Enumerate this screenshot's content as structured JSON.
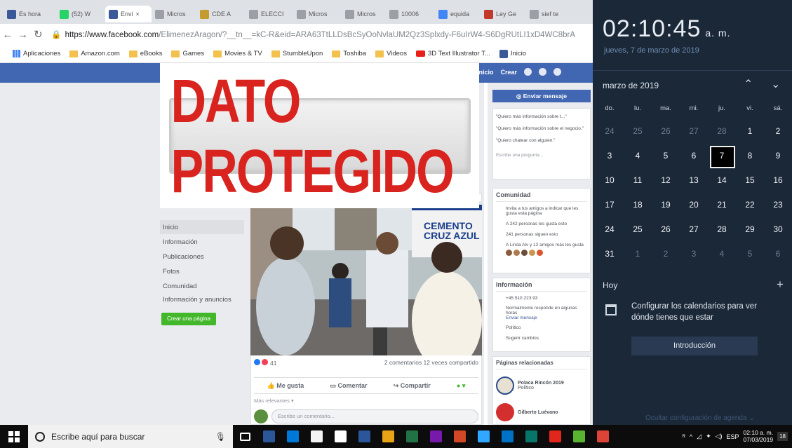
{
  "browser": {
    "tabs": [
      {
        "label": "Es hora",
        "color": "#3b5998"
      },
      {
        "label": "(52) W",
        "color": "#25d366"
      },
      {
        "label": "Envi",
        "color": "#3b5998",
        "active": true
      },
      {
        "label": "Micros",
        "color": "#9aa0a6"
      },
      {
        "label": "CDE A",
        "color": "#c49b2d"
      },
      {
        "label": "ELECCI",
        "color": "#9aa0a6"
      },
      {
        "label": "Micros",
        "color": "#9aa0a6"
      },
      {
        "label": "Micros",
        "color": "#9aa0a6"
      },
      {
        "label": "10006",
        "color": "#9aa0a6"
      },
      {
        "label": "equida",
        "color": "#4285f4"
      },
      {
        "label": "Ley Ge",
        "color": "#c0392b"
      },
      {
        "label": "sief te",
        "color": "#9aa0a6"
      }
    ],
    "close_glyph": "×",
    "url_main": "https://www.facebook.com",
    "url_rest": "/ElimenezAragon/?__tn__=kC-R&eid=ARA63TtLLDsBcSyOoNvlaUM2Qz3Splxdy-F6uIrW4-S6DgRUtLI1xD4WC8brA",
    "bookmarks": [
      {
        "label": "Aplicaciones",
        "icon": "apps-grid-icon"
      },
      {
        "label": "Amazon.com",
        "icon": "folder-icon"
      },
      {
        "label": "eBooks",
        "icon": "folder-icon"
      },
      {
        "label": "Games",
        "icon": "folder-icon"
      },
      {
        "label": "Movies & TV",
        "icon": "folder-icon"
      },
      {
        "label": "StumbleUpon",
        "icon": "folder-icon"
      },
      {
        "label": "Toshiba",
        "icon": "folder-icon"
      },
      {
        "label": "Videos",
        "icon": "folder-icon"
      },
      {
        "label": "3D Text Illustrator T...",
        "icon": "youtube-icon"
      },
      {
        "label": "Inicio",
        "icon": "facebook-icon"
      }
    ]
  },
  "facebook": {
    "nav_home": "Inicio",
    "nav_create": "Crear",
    "banner_text": "DATO PROTEGIDO",
    "side_menu": [
      "Inicio",
      "Información",
      "Publicaciones",
      "Fotos",
      "Comunidad",
      "Información y anuncios"
    ],
    "create_page_button": "Crear una página",
    "post": {
      "reactions_count": "41",
      "comments_shares": "2 comentarios  12 veces compartido",
      "like_label": "Me gusta",
      "comment_label": "Comentar",
      "share_label": "Compartir",
      "sort_label": "Más relevantes ▾",
      "comment_placeholder": "Escribe un comentario...",
      "sign_line1": "CEMENTO",
      "sign_line2": "CRUZ AZUL"
    },
    "messenger": {
      "button": "Enviar mensaje",
      "suggestions": [
        "\"Quiero más información sobre t...\"",
        "\"Quiero más información sobre el negocio.\"",
        "\"Quiero chatear con alguien.\""
      ],
      "ask_placeholder": "Escribe una pregunta..."
    },
    "community": {
      "title": "Comunidad",
      "items": [
        "Invita a tus amigos a indicar que les gusta esta página",
        "A 242 personas les gusta esto",
        "241 personas siguen esto",
        "A Linda Alv y 12 amigos más les gusta"
      ]
    },
    "info": {
      "title": "Información",
      "phone": "+45 510 223 93",
      "response": "Normalmente responde en algunas horas",
      "send_message": "Enviar mensaje",
      "category": "Político",
      "suggest": "Sugerir cambios"
    },
    "related": {
      "title": "Páginas relacionadas",
      "pages": [
        {
          "name": "Polaca Rincón 2019",
          "category": "Político"
        },
        {
          "name": "Gilberto Luévano",
          "category": ""
        }
      ]
    }
  },
  "calendar": {
    "time": "02:10:45",
    "ampm": "a. m.",
    "date_line": "jueves, 7 de marzo de 2019",
    "month_label": "marzo de 2019",
    "weekdays": [
      "do.",
      "lu.",
      "ma.",
      "mi.",
      "ju.",
      "vi.",
      "sá."
    ],
    "weeks": [
      [
        "24",
        "25",
        "26",
        "27",
        "28",
        "1",
        "2"
      ],
      [
        "3",
        "4",
        "5",
        "6",
        "7",
        "8",
        "9"
      ],
      [
        "10",
        "11",
        "12",
        "13",
        "14",
        "15",
        "16"
      ],
      [
        "17",
        "18",
        "19",
        "20",
        "21",
        "22",
        "23"
      ],
      [
        "24",
        "25",
        "26",
        "27",
        "28",
        "29",
        "30"
      ],
      [
        "31",
        "1",
        "2",
        "3",
        "4",
        "5",
        "6"
      ]
    ],
    "selected_day": "7",
    "today_label": "Hoy",
    "config_msg": "Configurar los calendarios para ver dónde tienes que estar",
    "intro_button": "Introducción",
    "agenda_link": "Ocultar configuración de agenda ⌄"
  },
  "taskbar": {
    "search_placeholder": "Escribe aquí para buscar",
    "apps": [
      {
        "name": "task-view-icon",
        "color": "#ffffff"
      },
      {
        "name": "word-app-icon",
        "color": "#2b579a"
      },
      {
        "name": "edge-app-icon",
        "color": "#0078d7"
      },
      {
        "name": "store-app-icon",
        "color": "#f3f3f3"
      },
      {
        "name": "mail-app-icon",
        "color": "#ffffff"
      },
      {
        "name": "word-doc-icon",
        "color": "#2b579a"
      },
      {
        "name": "chrome-app-icon",
        "color": "#e8a317"
      },
      {
        "name": "excel-app-icon",
        "color": "#217346"
      },
      {
        "name": "onenote-app-icon",
        "color": "#7719aa"
      },
      {
        "name": "powerpoint-app-icon",
        "color": "#d24726"
      },
      {
        "name": "photoshop-app-icon",
        "color": "#31a8ff"
      },
      {
        "name": "outlook-app-icon",
        "color": "#0072c6"
      },
      {
        "name": "publisher-app-icon",
        "color": "#077568"
      },
      {
        "name": "acrobat-app-icon",
        "color": "#e1261c"
      },
      {
        "name": "media-app-icon",
        "color": "#5ab330"
      },
      {
        "name": "chrome2-app-icon",
        "color": "#db4437"
      }
    ],
    "tray_lang": "ESP",
    "tray_time": "02:10 a. m.",
    "tray_date": "07/03/2019",
    "notif_count": "18"
  }
}
